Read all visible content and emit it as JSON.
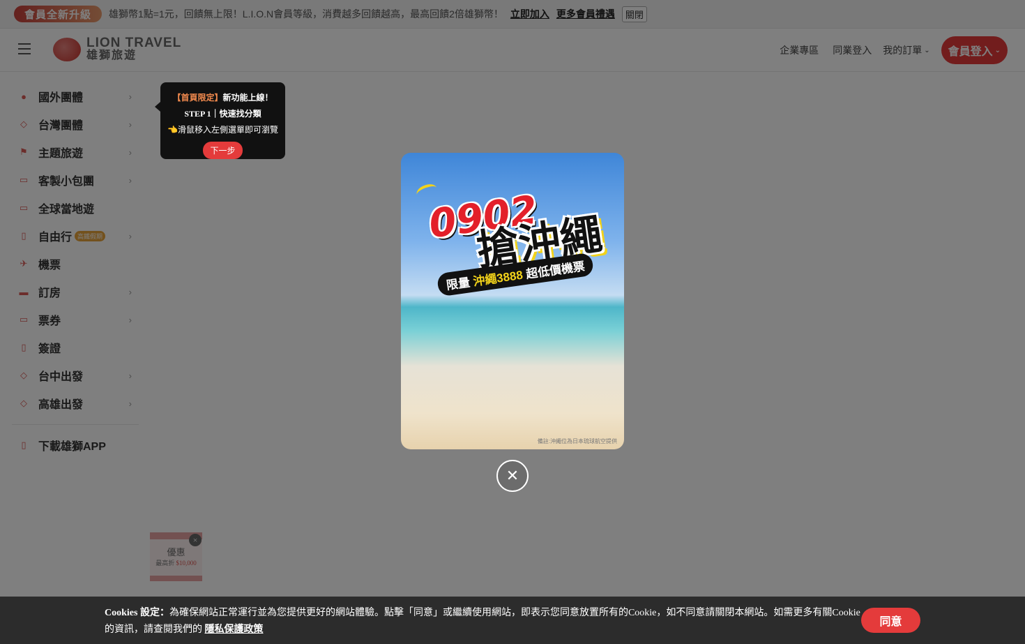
{
  "announcement": {
    "upgrade_label": "會員全新升級",
    "message": "雄獅幣1點=1元，回饋無上限！L.I.O.N會員等級，消費越多回饋越高，最高回饋2倍雄獅幣！",
    "join_link": "立即加入",
    "benefits_link": "更多會員禮遇",
    "close_label": "關閉"
  },
  "header": {
    "logo_en": "LION TRAVEL",
    "logo_zh": "雄獅旅遊",
    "nav": {
      "corporate": "企業專區",
      "partner_login": "同業登入",
      "my_orders": "我的訂單",
      "member_login": "會員登入"
    }
  },
  "sidebar": {
    "items": [
      {
        "label": "國外團體",
        "icon": "globe-icon",
        "has_arrow": true
      },
      {
        "label": "台灣團體",
        "icon": "taiwan-icon",
        "has_arrow": true
      },
      {
        "label": "主題旅遊",
        "icon": "flag-icon",
        "has_arrow": true
      },
      {
        "label": "客製小包團",
        "icon": "van-icon",
        "has_arrow": true
      },
      {
        "label": "全球當地遊",
        "icon": "bus-icon",
        "has_arrow": false
      },
      {
        "label": "自由行",
        "icon": "luggage-icon",
        "has_arrow": true,
        "badge": "高鐵假期"
      },
      {
        "label": "機票",
        "icon": "plane-icon",
        "has_arrow": false
      },
      {
        "label": "訂房",
        "icon": "bed-icon",
        "has_arrow": true
      },
      {
        "label": "票券",
        "icon": "ticket-icon",
        "has_arrow": true
      },
      {
        "label": "簽證",
        "icon": "passport-icon",
        "has_arrow": false
      },
      {
        "label": "台中出發",
        "icon": "taichung-icon",
        "has_arrow": true
      },
      {
        "label": "高雄出發",
        "icon": "kaohsiung-icon",
        "has_arrow": true
      }
    ],
    "app_label": "下載雄獅APP"
  },
  "tooltip": {
    "tag": "【首頁限定】",
    "line1": "新功能上線！",
    "line2": "STEP 1｜快速找分類",
    "line3": "👈滑鼠移入左側選單即可瀏覽",
    "next_label": "下一步"
  },
  "float_promo": {
    "title": "優惠",
    "sub_prefix": "最高折",
    "amount": "$10,000"
  },
  "ad": {
    "title_date": "0902",
    "title_main": "搶沖繩",
    "banner_prefix": "限量",
    "banner_highlight": "沖繩3888",
    "banner_suffix": "超低價機票",
    "note": "備註:沖繩位為日本琉球航空提供"
  },
  "cookie": {
    "title": "Cookies 設定：",
    "text": "為確保網站正常運行並為您提供更好的網站體驗。點擊「同意」或繼續使用網站，即表示您同意放置所有的Cookie，如不同意請關閉本網站。如需更多有關Cookie的資訊，請查閱我們的 ",
    "policy_link": "隱私保護政策",
    "agree_label": "同意"
  }
}
